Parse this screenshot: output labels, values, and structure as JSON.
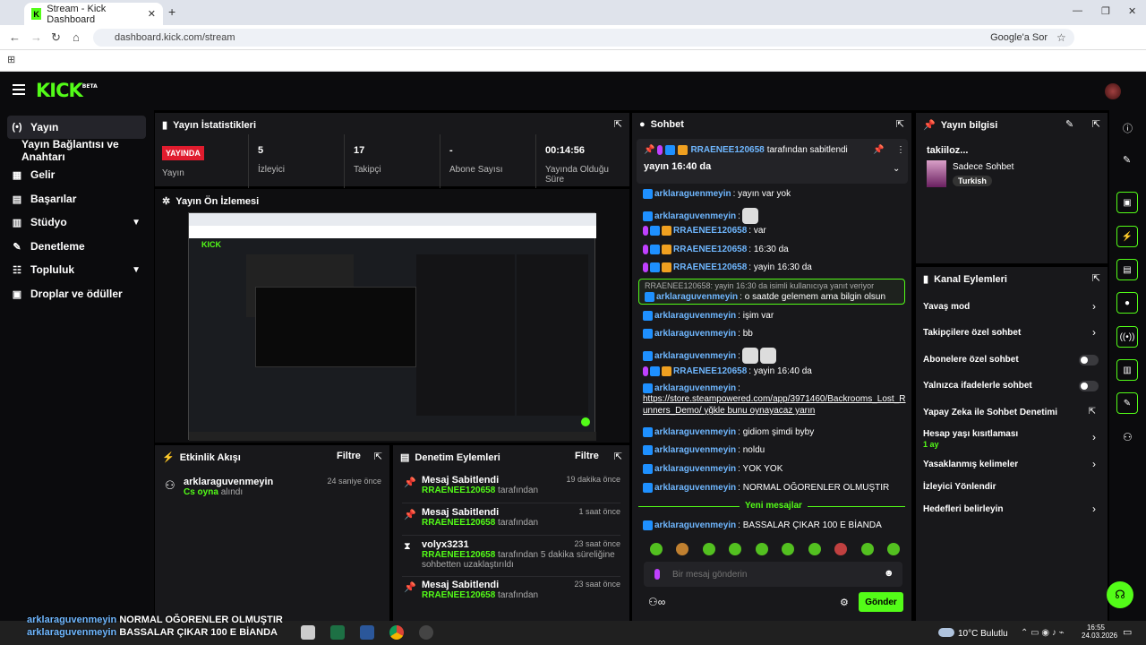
{
  "browser": {
    "tab_title": "Stream - Kick Dashboard",
    "url": "dashboard.kick.com/stream",
    "google": "Google'a Sor"
  },
  "header": {
    "logo": "KICK",
    "beta": "BETA"
  },
  "sidebar": {
    "items": [
      {
        "label": "Yayın",
        "icon": "(•)"
      },
      {
        "label": "Yayın Bağlantısı ve Anahtarı",
        "icon": ""
      },
      {
        "label": "Gelir",
        "icon": "▦"
      },
      {
        "label": "Başarılar",
        "icon": "▤"
      },
      {
        "label": "Stüdyo",
        "icon": "▥"
      },
      {
        "label": "Denetleme",
        "icon": "🔧"
      },
      {
        "label": "Topluluk",
        "icon": "👥"
      },
      {
        "label": "Droplar ve ödüller",
        "icon": "▣"
      }
    ]
  },
  "stats": {
    "title": "Yayın İstatistikleri",
    "live": "YAYINDA",
    "live_label": "Yayın",
    "viewers": "5",
    "viewers_label": "İzleyici",
    "followers": "17",
    "followers_label": "Takipçi",
    "subs": "-",
    "subs_label": "Abone Sayısı",
    "uptime": "00:14:56",
    "uptime_label": "Yayında Olduğu Süre"
  },
  "preview": {
    "title": "Yayın Ön İzlemesi"
  },
  "activity": {
    "title": "Etkinlik Akışı",
    "filter": "Filtre",
    "items": [
      {
        "user": "arklaraguvenmeyin",
        "detail": "Cs oyna",
        "suffix": "alındı",
        "time": "24 saniye önce"
      }
    ]
  },
  "modlog": {
    "title": "Denetim Eylemleri",
    "filter": "Filtre",
    "items": [
      {
        "title": "Mesaj Sabitlendi",
        "by": "RRAENEE120658",
        "suffix": "tarafından",
        "extra": "",
        "time": "19 dakika önce"
      },
      {
        "title": "Mesaj Sabitlendi",
        "by": "RRAENEE120658",
        "suffix": "tarafından",
        "extra": "",
        "time": "1 saat önce"
      },
      {
        "title": "volyx3231",
        "by": "RRAENEE120658",
        "suffix": "tarafından 5 dakika süreliğine",
        "extra": "sohbetten uzaklaştırıldı",
        "time": "23 saat önce"
      },
      {
        "title": "Mesaj Sabitlendi",
        "by": "RRAENEE120658",
        "suffix": "tarafından",
        "extra": "",
        "time": "23 saat önce"
      }
    ]
  },
  "chat": {
    "title": "Sohbet",
    "pinned_by": "RRAENEE120658",
    "pinned_suffix": "tarafından sabitlendi",
    "pinned_msg": "yayın 16:40 da",
    "lines": [
      {
        "user": "arklaraguenmeyin",
        "text": ": yayın var yok",
        "mod": false
      },
      {
        "user": "arklaraguvenmeyin",
        "text": ": ",
        "mod": false
      },
      {
        "user": "RRAENEE120658",
        "text": ": var",
        "mod": true
      },
      {
        "user": "RRAENEE120658",
        "text": ": 16:30 da",
        "mod": true
      },
      {
        "user": "RRAENEE120658",
        "text": ": yayin 16:30 da",
        "mod": true
      }
    ],
    "reply_ref": "RRAENEE120658: yayin 16:30 da isimli kullanıcıya yanıt veriyor",
    "reply_user": "arklaraguvenmeyin",
    "reply_text": ": o saatde gelemem ama bilgin olsun",
    "lines2": [
      {
        "user": "arklaraguvenmeyin",
        "text": ": işim var"
      },
      {
        "user": "arklaraguvenmeyin",
        "text": ": bb"
      },
      {
        "user": "arklaraguvenmeyin",
        "text": ":"
      }
    ],
    "mod_line": {
      "user": "RRAENEE120658",
      "text": ": yayin 16:40 da"
    },
    "link_user": "arklaraguvenmeyin",
    "link": "https://store.steampowered.com/app/3971460/Backrooms_Lost_Runners_Demo/",
    "link_after": "yğkle bunu oynayacaz yarın",
    "lines3": [
      {
        "user": "arklaraguvenmeyin",
        "text": ": gidiom şimdi byby"
      },
      {
        "user": "arklaraguvenmeyin",
        "text": ": noldu"
      },
      {
        "user": "arklaraguvenmeyin",
        "text": ": YOK YOK"
      },
      {
        "user": "arklaraguvenmeyin",
        "text": ": NORMAL OĞORENLER OLMUŞTIR"
      }
    ],
    "new_messages": "Yeni mesajlar",
    "last": {
      "user": "arklaraguvenmeyin",
      "text": ": BASSALAR ÇIKAR 100 E BİANDA"
    },
    "input_placeholder": "Bir mesaj gönderin",
    "send": "Gönder"
  },
  "info": {
    "title": "Yayın bilgisi",
    "stream_title": "takiiloz...",
    "category": "Sadece Sohbet",
    "lang": "Turkish"
  },
  "channel": {
    "title": "Kanal Eylemleri",
    "items": [
      {
        "label": "Yavaş mod",
        "sub": "",
        "kind": "arrow"
      },
      {
        "label": "Takipçilere özel sohbet",
        "sub": "",
        "kind": "arrow"
      },
      {
        "label": "Abonelere özel sohbet",
        "sub": "",
        "kind": "toggle"
      },
      {
        "label": "Yalnızca ifadelerle sohbet",
        "sub": "",
        "kind": "toggle"
      },
      {
        "label": "Yapay Zeka ile Sohbet Denetimi",
        "sub": "",
        "kind": "ext"
      },
      {
        "label": "Hesap yaşı kısıtlaması",
        "sub": "1 ay",
        "kind": "arrow"
      },
      {
        "label": "Yasaklanmış kelimeler",
        "sub": "",
        "kind": "arrow"
      },
      {
        "label": "İzleyici Yönlendir",
        "sub": "",
        "kind": "none"
      },
      {
        "label": "Hedefleri belirleyin",
        "sub": "",
        "kind": "arrow"
      }
    ]
  },
  "overlay": {
    "line1_user": "arklaraguvenmeyin",
    "line1": "NORMAL OĞORENLER OLMUŞTIR",
    "line2_user": "arklaraguvenmeyin",
    "line2": "BASSALAR ÇIKAR 100 E BİANDA"
  },
  "taskbar": {
    "weather": "10°C",
    "weather_label": "Bulutlu",
    "time": "16:55",
    "date": "24.03.2026"
  },
  "colors": {
    "accent": "#53fc18",
    "panel": "#18181b",
    "bg": "#000000"
  }
}
